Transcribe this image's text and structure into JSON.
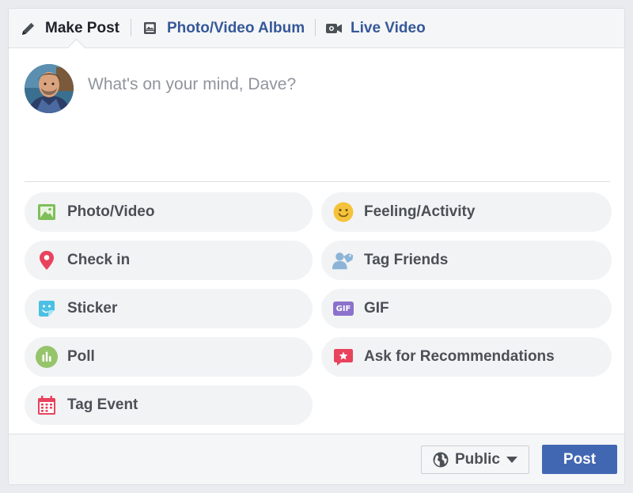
{
  "tabs": [
    {
      "label": "Make Post",
      "icon": "pencil-icon",
      "active": true
    },
    {
      "label": "Photo/Video Album",
      "icon": "album-icon",
      "active": false
    },
    {
      "label": "Live Video",
      "icon": "video-camera-icon",
      "active": false
    }
  ],
  "composer": {
    "placeholder": "What's on your mind, Dave?"
  },
  "options": [
    {
      "label": "Photo/Video",
      "icon": "photo-icon",
      "color": "#7fbf5a"
    },
    {
      "label": "Feeling/Activity",
      "icon": "smiley-icon",
      "color": "#f5c33b"
    },
    {
      "label": "Check in",
      "icon": "location-pin-icon",
      "color": "#e9425d"
    },
    {
      "label": "Tag Friends",
      "icon": "tag-friends-icon",
      "color": "#8cb4d6"
    },
    {
      "label": "Sticker",
      "icon": "sticker-icon",
      "color": "#4cc0e4"
    },
    {
      "label": "GIF",
      "icon": "gif-icon",
      "color": "#8b71cc",
      "badge": "GIF"
    },
    {
      "label": "Poll",
      "icon": "poll-icon",
      "color": "#96c46b"
    },
    {
      "label": "Ask for Recommendations",
      "icon": "recommendation-icon",
      "color": "#e9425d"
    },
    {
      "label": "Tag Event",
      "icon": "calendar-icon",
      "color": "#e9425d"
    }
  ],
  "footer": {
    "audience_label": "Public",
    "post_label": "Post"
  },
  "colors": {
    "brand_blue": "#4267b2",
    "link_blue": "#365899"
  }
}
